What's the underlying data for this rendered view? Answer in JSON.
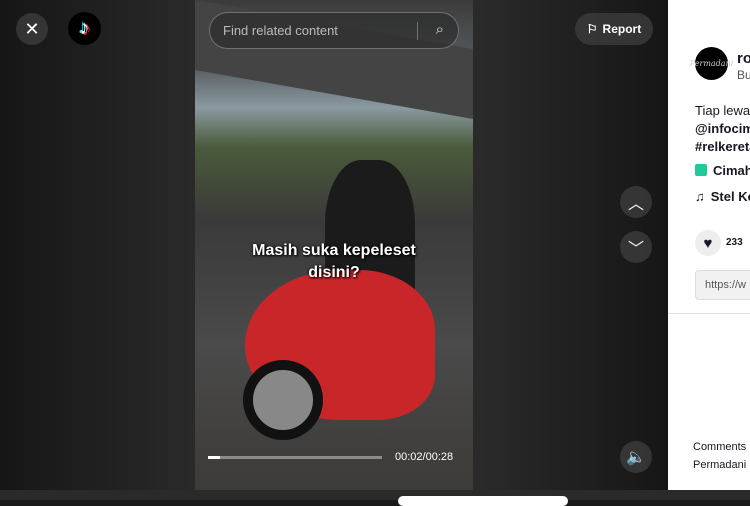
{
  "video": {
    "caption_line1": "Masih suka kepeleset",
    "caption_line2": "disini?",
    "current_time": "00:02/00:28",
    "progress_fraction": 0.07
  },
  "search": {
    "placeholder": "Find related content"
  },
  "buttons": {
    "report": "Report"
  },
  "panel": {
    "username": "ro",
    "subname": "Bu",
    "description_line1": "Tiap lewa",
    "mention": "@infocim",
    "hashtag": "#relkereta",
    "location": "Cimah",
    "music": "Stel Ke",
    "likes": "233",
    "link": "https://w",
    "comments_tab": "Comments",
    "comment_author": "Permadani",
    "avatar_text": "Permadani"
  },
  "colors": {
    "location_icon": "#20c997",
    "panel_bg": "#ffffff"
  }
}
